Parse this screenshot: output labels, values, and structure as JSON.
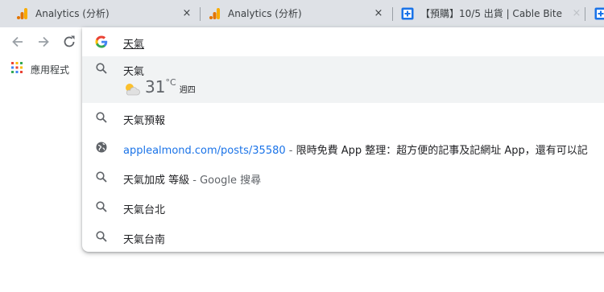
{
  "tabs": [
    {
      "title": "Analytics (分析)",
      "favicon": "analytics-icon",
      "close": "×"
    },
    {
      "title": "Analytics (分析)",
      "favicon": "analytics-icon",
      "close": "×"
    },
    {
      "title": "【預購】10/5 出貨 | Cable Bite",
      "favicon": "plus-box-icon",
      "close": "×"
    }
  ],
  "bookmarks": {
    "apps_label": "應用程式"
  },
  "omnibox": {
    "query": "天氣"
  },
  "suggestions": {
    "weather": {
      "title": "天氣",
      "temperature": "31",
      "unit": "°C",
      "day": "週四",
      "icon": "partly-cloudy-icon"
    },
    "items": [
      {
        "text": "天氣預報",
        "icon": "search-icon"
      },
      {
        "url": "applealmond.com/posts/35580",
        "sep": " - ",
        "desc": "限時免費 App 整理：超方便的記事及記網址 App，還有可以記",
        "icon": "globe-icon"
      },
      {
        "text": "天氣加成 等級",
        "sep": " - ",
        "desc": "Google 搜尋",
        "icon": "search-icon"
      },
      {
        "text": "天氣台北",
        "icon": "search-icon"
      },
      {
        "text": "天氣台南",
        "icon": "search-icon"
      }
    ]
  },
  "colors": {
    "link": "#1a73e8",
    "tabstrip": "#dee1e6",
    "highlight": "#f1f3f4"
  }
}
